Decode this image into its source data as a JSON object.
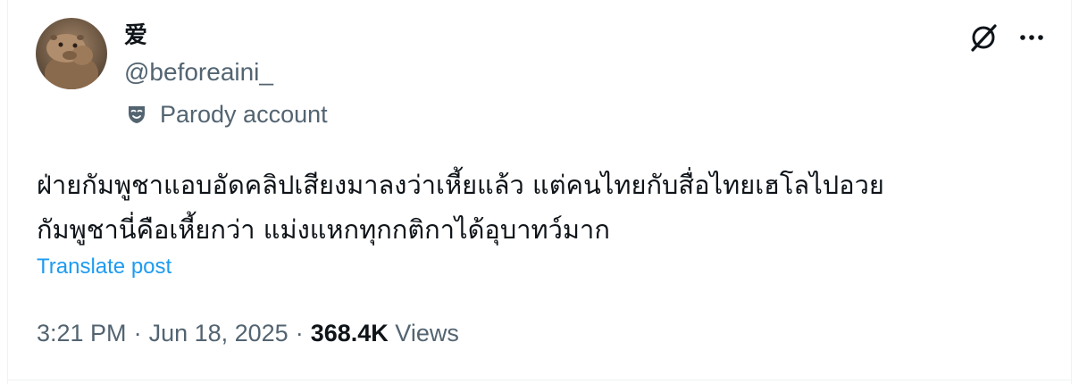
{
  "author": {
    "display_name": "爱",
    "handle": "@beforeaini_",
    "parody_label": "Parody account",
    "avatar_icon": "capybara-avatar"
  },
  "header_icons": {
    "grok": "grok-icon",
    "more": "more-icon"
  },
  "tweet": {
    "lines": [
      "ฝ่ายกัมพูชาแอบอัดคลิปเสียงมาลงว่าเหี้ยแล้ว แต่คนไทยกับสื่อไทยเฮโลไปอวย",
      "กัมพูชานี่คือเหี้ยกว่า แม่งแหกทุกกติกาได้อุบาทว์มาก"
    ],
    "translate_label": "Translate post"
  },
  "meta": {
    "time": "3:21 PM",
    "separator": "·",
    "date": "Jun 18, 2025",
    "views_count": "368.4K",
    "views_label": "Views"
  },
  "colors": {
    "text_primary": "#0f1419",
    "text_secondary": "#536471",
    "link": "#1d9bf0",
    "border": "#eff3f4"
  }
}
